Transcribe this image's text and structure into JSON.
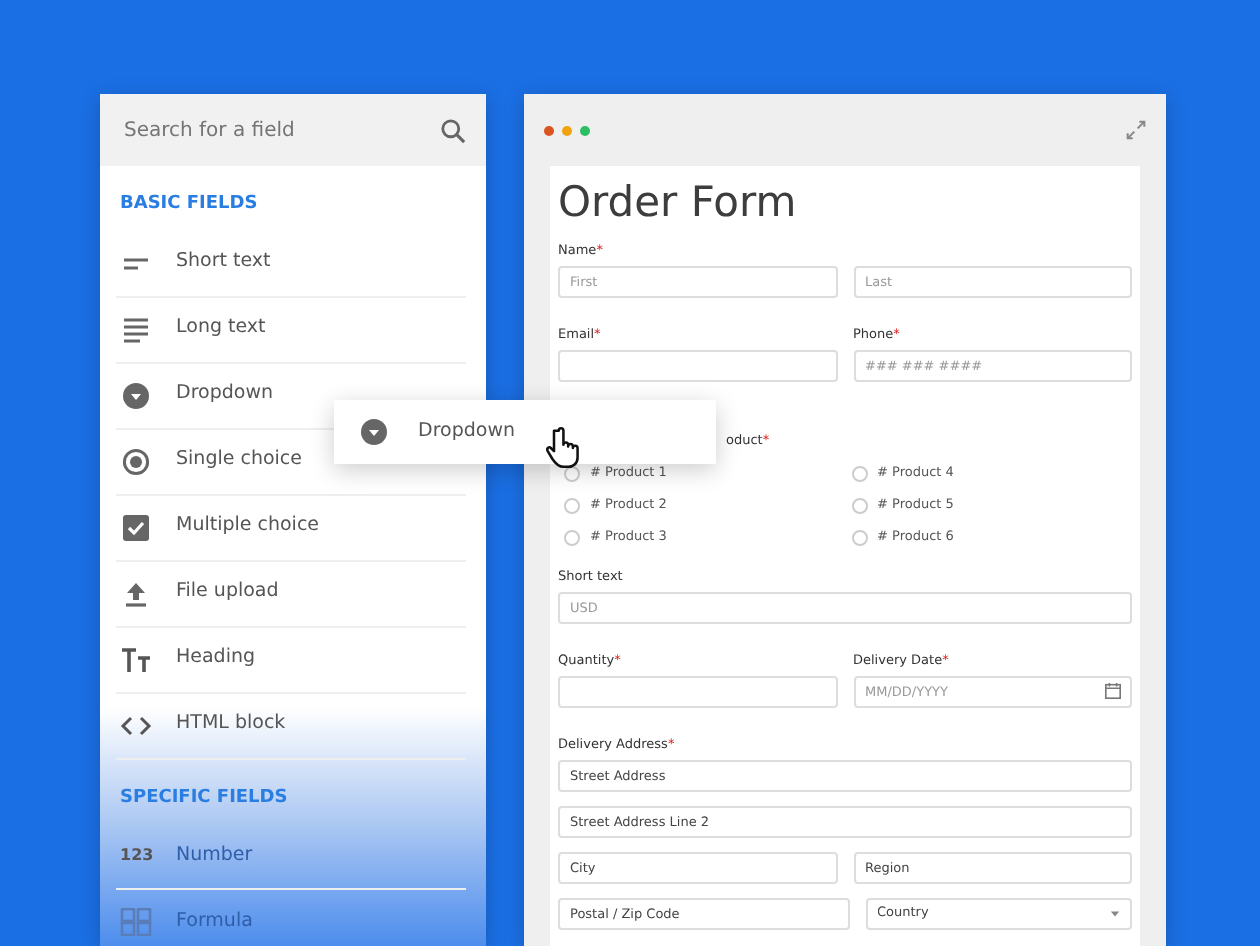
{
  "sidebar": {
    "search": {
      "placeholder": "Search for a field"
    },
    "sections": [
      {
        "heading": "BASIC FIELDS",
        "items": [
          {
            "label": "Short text",
            "kind": "short"
          },
          {
            "label": "Long text",
            "kind": "long"
          },
          {
            "label": "Dropdown",
            "kind": "dropdown"
          },
          {
            "label": "Single choice",
            "kind": "radio"
          },
          {
            "label": "Multiple choice",
            "kind": "checkbox"
          },
          {
            "label": "File upload",
            "kind": "upload"
          },
          {
            "label": "Heading",
            "kind": "heading"
          },
          {
            "label": "HTML block",
            "kind": "code"
          }
        ]
      },
      {
        "heading": "SPECIFIC FIELDS",
        "items": [
          {
            "label": "Number",
            "kind": "text",
            "icon_text": "123"
          },
          {
            "label": "Formula",
            "kind": "formula"
          }
        ]
      }
    ]
  },
  "drag_item": {
    "label": "Dropdown"
  },
  "form": {
    "title": "Order Form",
    "rows": [
      {
        "fields": [
          {
            "label": "Name",
            "required_mark": "*",
            "inputs": [
              [
                {
                  "kind": "text",
                  "placeholder": "First"
                },
                {
                  "kind": "text",
                  "placeholder": "Last"
                }
              ]
            ]
          }
        ]
      },
      {
        "fields": [
          {
            "label": "Email",
            "required_mark": "*",
            "inputs": [
              [
                {
                  "kind": "text"
                }
              ]
            ]
          },
          {
            "label": "Phone",
            "required_mark": "*",
            "inputs": [
              [
                {
                  "kind": "text",
                  "placeholder": "### ### ####"
                }
              ]
            ]
          }
        ]
      },
      {
        "fields": [
          {
            "kind": "choice",
            "label": "oduct",
            "required_mark": "*",
            "options": [
              {
                "label": "# Product 1",
                "selected": false
              },
              {
                "label": "# Product 2",
                "selected": false
              },
              {
                "label": "# Product 3",
                "selected": false
              },
              {
                "label": "# Product 4",
                "selected": false
              },
              {
                "label": "# Product 5",
                "selected": false
              },
              {
                "label": "# Product 6",
                "selected": false
              }
            ]
          }
        ]
      },
      {
        "fields": [
          {
            "label": "Short text",
            "inputs": [
              [
                {
                  "kind": "text",
                  "placeholder": "USD"
                }
              ]
            ]
          }
        ]
      },
      {
        "fields": [
          {
            "label": "Quantity",
            "required_mark": "*",
            "inputs": [
              [
                {
                  "kind": "text"
                }
              ]
            ]
          },
          {
            "label": "Delivery Date",
            "required_mark": "*",
            "inputs": [
              [
                {
                  "kind": "date",
                  "placeholder": "MM/DD/YYYY"
                }
              ]
            ]
          }
        ]
      },
      {
        "fields": [
          {
            "label": "Delivery Address",
            "required_mark": "*",
            "inputs": [
              [
                {
                  "kind": "text",
                  "value": "Street Address"
                }
              ],
              [
                {
                  "kind": "text",
                  "value": "Street Address Line 2"
                }
              ],
              [
                {
                  "kind": "text",
                  "value": "City"
                },
                {
                  "kind": "text",
                  "value": "Region"
                }
              ],
              [
                {
                  "kind": "text",
                  "value": "Postal / Zip Code"
                },
                {
                  "kind": "select",
                  "placeholder": "Country"
                }
              ]
            ]
          }
        ]
      }
    ]
  }
}
